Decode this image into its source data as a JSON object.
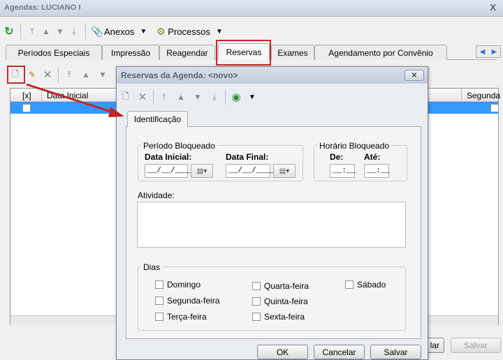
{
  "window": {
    "title": "Agendas: LUCIANO I",
    "close": "X"
  },
  "toolbar": {
    "anexos": "Anexos",
    "processos": "Processos"
  },
  "tabs": [
    {
      "label": "Períodos Especiais"
    },
    {
      "label": "Impressão"
    },
    {
      "label": "Reagendar"
    },
    {
      "label": "Reservas"
    },
    {
      "label": "Exames"
    },
    {
      "label": "Agendamento por Convênio"
    }
  ],
  "grid": {
    "col_check": "[x]",
    "col_data_inicial": "Data Inicial",
    "col_segunda": "Segunda"
  },
  "main_buttons": {
    "partial": "lar",
    "salvar": "Salvar"
  },
  "dialog": {
    "title": "Reservas da Agenda: <novo>",
    "tab": "Identificação",
    "periodo": {
      "legend": "Período Bloqueado",
      "data_inicial": "Data Inicial:",
      "data_final": "Data Final:",
      "date_mask": "__/__/____"
    },
    "horario": {
      "legend": "Horário Bloqueado",
      "de": "De:",
      "ate": "Até:",
      "time_mask": "__:__"
    },
    "atividade_label": "Atividade:",
    "dias": {
      "legend": "Dias",
      "items": [
        "Domingo",
        "Segunda-feira",
        "Terça-feira",
        "Quarta-feira",
        "Quinta-feira",
        "Sexta-feira",
        "Sábado"
      ]
    },
    "buttons": {
      "ok": "OK",
      "cancelar": "Cancelar",
      "salvar": "Salvar"
    }
  },
  "colors": {
    "selection": "#3399ff",
    "highlight": "#c8262b"
  }
}
